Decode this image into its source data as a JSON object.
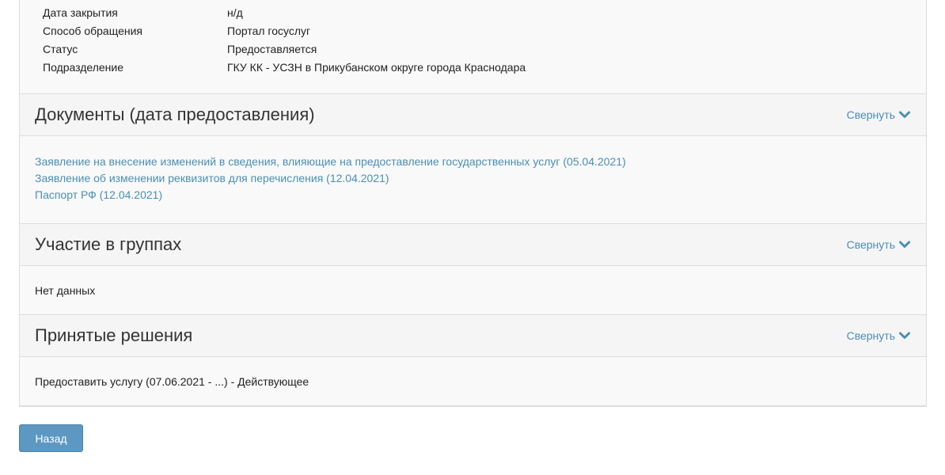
{
  "info": {
    "rows": [
      {
        "label": "Дата закрытия",
        "value": "н/д"
      },
      {
        "label": "Способ обращения",
        "value": "Портал госуслуг"
      },
      {
        "label": "Статус",
        "value": "Предоставляется"
      },
      {
        "label": "Подразделение",
        "value": "ГКУ КК - УСЗН в Прикубанском округе города Краснодара"
      }
    ]
  },
  "documents": {
    "title": "Документы (дата предоставления)",
    "collapse_label": "Свернуть",
    "items": [
      "Заявление на внесение изменений в сведения, влияющие на предоставление государственных услуг (05.04.2021)",
      "Заявление об изменении реквизитов для перечисления (12.04.2021)",
      "Паспорт РФ (12.04.2021)"
    ]
  },
  "groups": {
    "title": "Участие в группах",
    "collapse_label": "Свернуть",
    "text": "Нет данных"
  },
  "decisions": {
    "title": "Принятые решения",
    "collapse_label": "Свернуть",
    "text": "Предоставить услугу (07.06.2021 - ...) - Действующее"
  },
  "back_button": "Назад",
  "colors": {
    "link": "#4a8fb5",
    "button": "#5d98c2"
  }
}
